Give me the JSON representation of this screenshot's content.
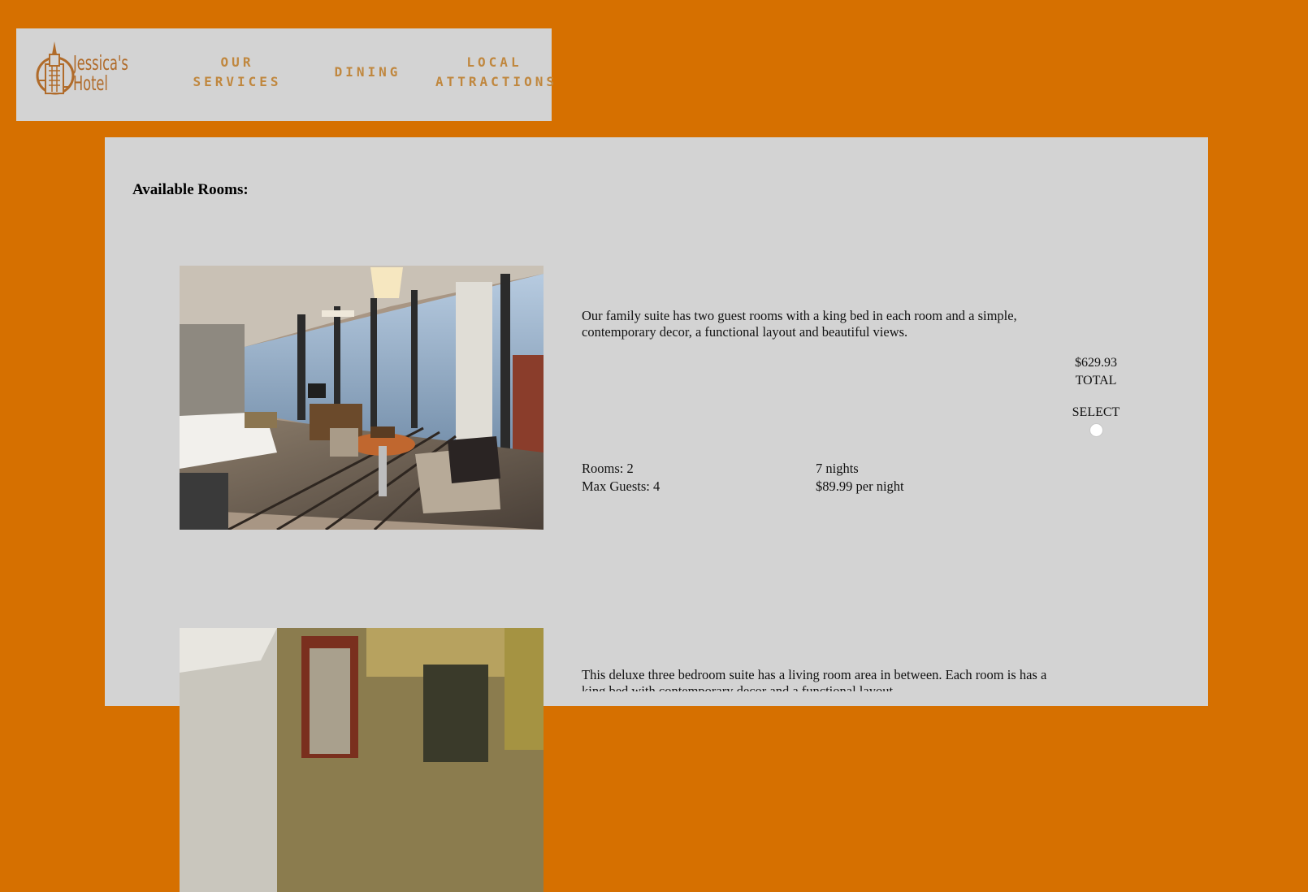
{
  "brand": {
    "line1": "Jessica's",
    "line2": "Hotel",
    "logo_icon": "building-emblem-icon"
  },
  "nav": {
    "services": {
      "line1": "OUR",
      "line2": "SERVICES"
    },
    "dining": {
      "label": "DINING"
    },
    "attractions": {
      "line1": "LOCAL",
      "line2": "ATTRACTIONS"
    }
  },
  "main": {
    "title": "Available Rooms:",
    "rooms": [
      {
        "photo_icon": "hotel-room-photo",
        "description": "Our family suite has two guest rooms with a king bed in each room and a simple, contemporary decor, a functional layout and beautiful views.",
        "rooms_text": "Rooms: 2",
        "guests_text": "Max Guests: 4",
        "nights_text": "7 nights",
        "rate_text": "$89.99 per night",
        "total": "$629.93",
        "total_label": "TOTAL",
        "select_label": "SELECT"
      },
      {
        "photo_icon": "hotel-room-photo",
        "description": "This deluxe three bedroom suite has a living room area in between. Each room is has a king bed with contemporary decor and a functional layout"
      }
    ]
  },
  "colors": {
    "background": "#d67000",
    "panel": "#d3d3d3",
    "nav_text": "#c0873e",
    "logo": "#b06b2a"
  }
}
